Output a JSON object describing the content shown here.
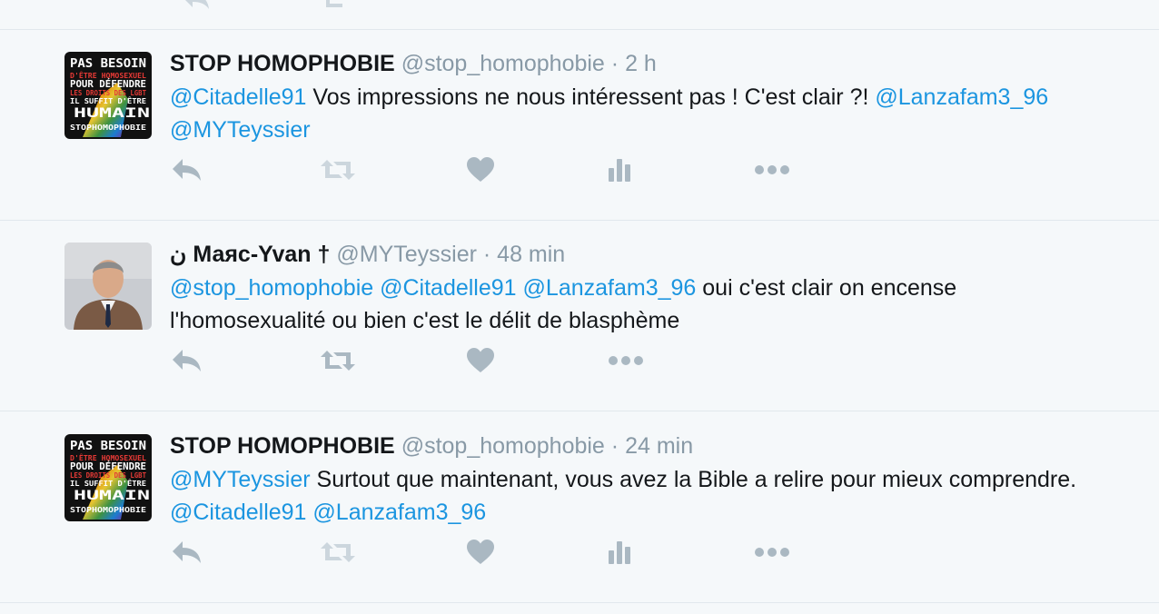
{
  "colors": {
    "background": "#f5f8fa",
    "divider": "#e1e8ed",
    "mention": "#1b95e0",
    "muted": "#8899a6",
    "action_icon": "#aab8c2",
    "action_icon_faded": "#ccd6dd"
  },
  "tweets": [
    {
      "fullname": "STOP HOMOPHOBIE",
      "fullname_prefix": "",
      "fullname_suffix": "",
      "username": "@stop_homophobie",
      "sep": "·",
      "time": "2 h",
      "avatar_lines": [
        "PAS BESOIN",
        "D'ÊTRE HOMOSEXUEL",
        "POUR DÉFENDRE",
        "LES DROITS DES LGBT",
        "IL SUFFIT D'ÊTRE",
        "HUMAIN",
        "STOPHOMOPHOBIE"
      ],
      "body": [
        {
          "type": "mention",
          "text": "@Citadelle91"
        },
        {
          "type": "text",
          "text": " Vos impressions ne nous intéressent pas ! C'est clair ?! "
        },
        {
          "type": "mention",
          "text": "@Lanzafam3_96"
        },
        {
          "type": "text",
          "text": " "
        },
        {
          "type": "mention",
          "text": "@MYTeyssier"
        }
      ],
      "actions": [
        "reply-icon",
        "retweet-icon",
        "like-icon",
        "analytics-icon",
        "more-icon"
      ]
    },
    {
      "fullname": "Маяс-Yvan",
      "fullname_prefix": "ن",
      "fullname_suffix": "†",
      "username": "@MYTeyssier",
      "sep": "·",
      "time": "48 min",
      "body": [
        {
          "type": "mention",
          "text": "@stop_homophobie"
        },
        {
          "type": "text",
          "text": " "
        },
        {
          "type": "mention",
          "text": "@Citadelle91"
        },
        {
          "type": "text",
          "text": " "
        },
        {
          "type": "mention",
          "text": "@Lanzafam3_96"
        },
        {
          "type": "text",
          "text": " oui c'est clair on encense l'homosexualité ou bien c'est le délit de blasphème"
        }
      ],
      "actions": [
        "reply-icon",
        "retweet-icon",
        "like-icon",
        "more-icon"
      ]
    },
    {
      "fullname": "STOP HOMOPHOBIE",
      "fullname_prefix": "",
      "fullname_suffix": "",
      "username": "@stop_homophobie",
      "sep": "·",
      "time": "24 min",
      "avatar_lines": [
        "PAS BESOIN",
        "D'ÊTRE HOMOSEXUEL",
        "POUR DÉFENDRE",
        "LES DROITS DES LGBT",
        "IL SUFFIT D'ÊTRE",
        "HUMAIN",
        "STOPHOMOPHOBIE"
      ],
      "body": [
        {
          "type": "mention",
          "text": "@MYTeyssier"
        },
        {
          "type": "text",
          "text": " Surtout que maintenant, vous avez la Bible a relire pour mieux comprendre. "
        },
        {
          "type": "mention",
          "text": "@Citadelle91"
        },
        {
          "type": "text",
          "text": " "
        },
        {
          "type": "mention",
          "text": "@Lanzafam3_96"
        }
      ],
      "actions": [
        "reply-icon",
        "retweet-icon",
        "like-icon",
        "analytics-icon",
        "more-icon"
      ]
    }
  ]
}
